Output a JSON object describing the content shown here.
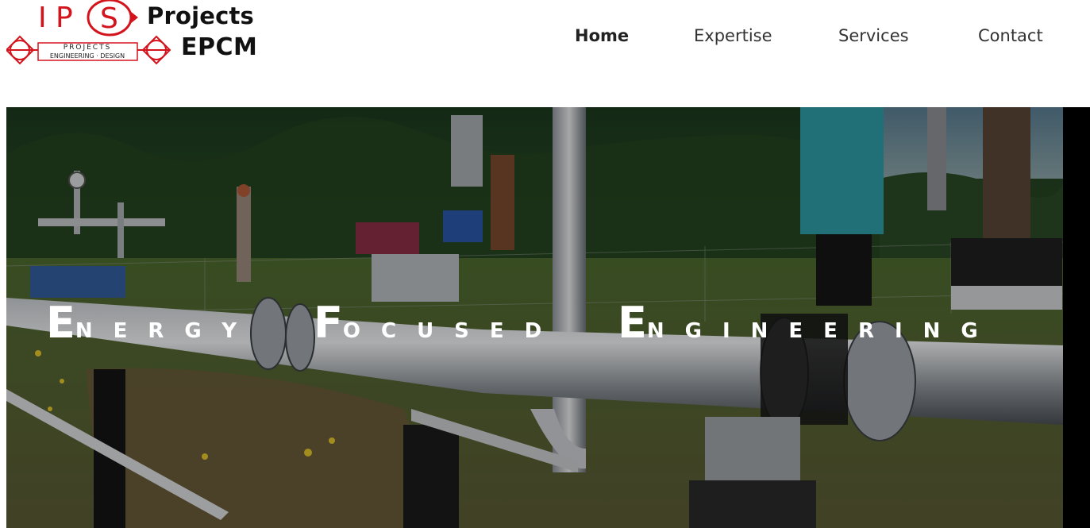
{
  "logo": {
    "letters_left": "I P",
    "letter_s": "S",
    "badge_top": "PROJECTS",
    "badge_bottom": "ENGINEERING · DESIGN",
    "title_line1": "Projects",
    "title_line2": "EPCM",
    "accent_color": "#d4141c"
  },
  "nav": {
    "items": [
      {
        "label": "Home",
        "active": true
      },
      {
        "label": "Expertise",
        "active": false
      },
      {
        "label": "Services",
        "active": false
      },
      {
        "label": "Contact",
        "active": false
      }
    ]
  },
  "hero": {
    "tagline": [
      {
        "cap": "E",
        "rest": "NERGY"
      },
      {
        "cap": "F",
        "rest": "OCUSED"
      },
      {
        "cap": "E",
        "rest": "NGINEERING"
      }
    ],
    "image_description_icon": "industrial-pipeline-photo"
  }
}
